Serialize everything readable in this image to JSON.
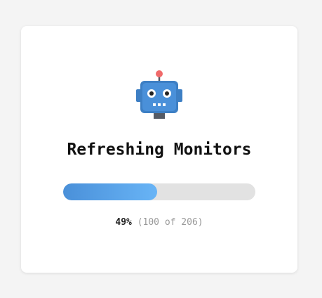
{
  "title": "Refreshing Monitors",
  "progress": {
    "percent_label": "49%",
    "count_label": "(100 of 206)",
    "fraction": 0.49
  },
  "icons": {
    "hero": "robot-icon"
  },
  "colors": {
    "accent": "#4a90d9",
    "accent_light": "#68b4f6",
    "robot_body": "#4a8fd6",
    "antenna_tip": "#f06a6a"
  }
}
